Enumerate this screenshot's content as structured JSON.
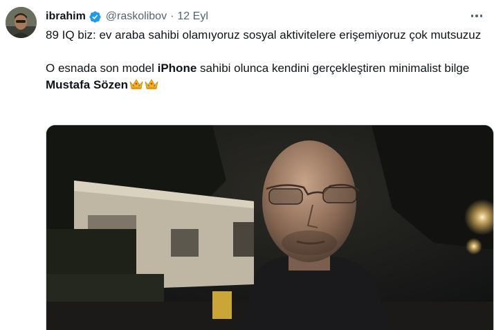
{
  "author": {
    "name": "ibrahim",
    "handle": "@raskolibov",
    "separator": "·",
    "timestamp": "12 Eyl",
    "verified": true,
    "avatar_icon": "avatar-photo"
  },
  "tweet": {
    "line1": "89 IQ biz: ev araba sahibi olamıyoruz sosyal aktivitelere erişemiyoruz çok mutsuzuz",
    "line2_pre": "O esnada son model ",
    "line2_bold1": "iPhone",
    "line2_mid": " sahibi olunca kendini gerçekleştiren minimalist bilge ",
    "line2_bold2": "Mustafa Sözen",
    "emojis": [
      "crown-emoji",
      "crown-emoji"
    ]
  },
  "media": {
    "type": "video-thumbnail",
    "description_icon": "video-frame"
  },
  "colors": {
    "text": "#0f1419",
    "secondary": "#536471",
    "verified": "#1d9bf0",
    "border": "#cfd9de"
  },
  "icons": {
    "more": "more-horizontal-icon",
    "verified": "verified-badge-icon"
  }
}
